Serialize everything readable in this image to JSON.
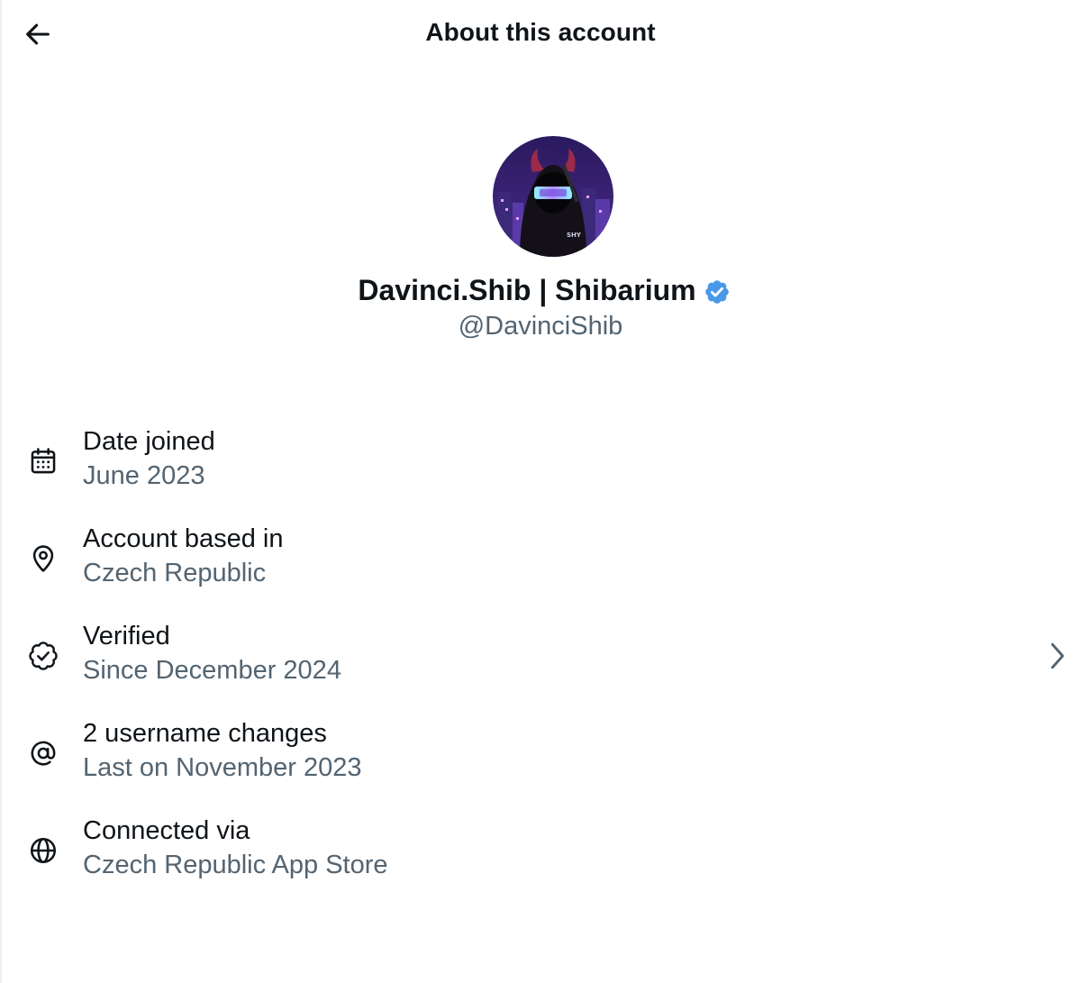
{
  "header": {
    "title": "About this account",
    "back_icon": "arrow-left-icon"
  },
  "profile": {
    "display_name": "Davinci.Shib | Shibarium",
    "handle": "@DavinciShib",
    "verified_badge_icon": "verified-badge-icon",
    "verified_color": "#4a99e9",
    "avatar_icon": "hooded-devil-avatar"
  },
  "info": {
    "date_joined": {
      "title": "Date joined",
      "value": "June 2023",
      "icon": "calendar-icon"
    },
    "based_in": {
      "title": "Account based in",
      "value": "Czech Republic",
      "icon": "location-pin-icon"
    },
    "verified": {
      "title": "Verified",
      "value": "Since December 2024",
      "icon": "verified-check-icon"
    },
    "username_changes": {
      "title": "2 username changes",
      "value": "Last on November 2023",
      "icon": "at-sign-icon"
    },
    "connected_via": {
      "title": "Connected via",
      "value": "Czech Republic App Store",
      "icon": "globe-icon"
    }
  },
  "colors": {
    "text_primary": "#0f1419",
    "text_secondary": "#536471",
    "background": "#ffffff"
  }
}
